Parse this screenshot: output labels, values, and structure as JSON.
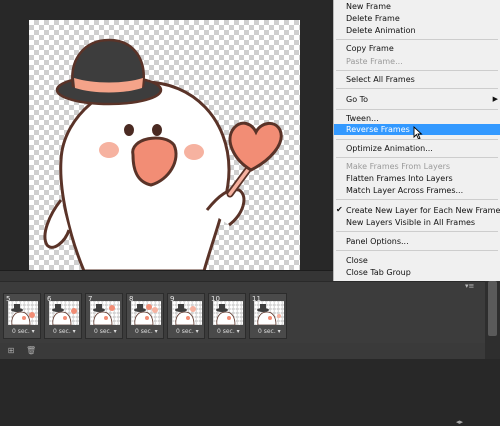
{
  "menu": {
    "items": [
      {
        "label": "New Frame",
        "state": "enabled"
      },
      {
        "label": "Delete Frame",
        "state": "enabled"
      },
      {
        "label": "Delete Animation",
        "state": "enabled"
      },
      {
        "label": "Copy Frame",
        "state": "enabled"
      },
      {
        "label": "Paste Frame...",
        "state": "disabled"
      },
      {
        "label": "Select All Frames",
        "state": "enabled"
      },
      {
        "label": "Go To",
        "state": "enabled",
        "submenu": true
      },
      {
        "label": "Tween...",
        "state": "enabled"
      },
      {
        "label": "Reverse Frames",
        "state": "highlighted"
      },
      {
        "label": "Optimize Animation...",
        "state": "enabled"
      },
      {
        "label": "Make Frames From Layers",
        "state": "disabled"
      },
      {
        "label": "Flatten Frames Into Layers",
        "state": "enabled"
      },
      {
        "label": "Match Layer Across Frames...",
        "state": "enabled"
      },
      {
        "label": "Create New Layer for Each New Frame",
        "state": "enabled",
        "checked": true
      },
      {
        "label": "New Layers Visible in All Frames",
        "state": "enabled"
      },
      {
        "label": "Panel Options...",
        "state": "enabled"
      },
      {
        "label": "Close",
        "state": "enabled"
      },
      {
        "label": "Close Tab Group",
        "state": "enabled"
      }
    ],
    "check_glyph": "✔",
    "submenu_glyph": "▶"
  },
  "timeline": {
    "frames": [
      {
        "number": "5",
        "delay": "0 sec."
      },
      {
        "number": "6",
        "delay": "0 sec."
      },
      {
        "number": "7",
        "delay": "0 sec."
      },
      {
        "number": "8",
        "delay": "0 sec."
      },
      {
        "number": "9",
        "delay": "0 sec."
      },
      {
        "number": "10",
        "delay": "0 sec."
      },
      {
        "number": "11",
        "delay": "0 sec."
      }
    ],
    "delay_arrow": "▾"
  },
  "colors": {
    "menu_highlight": "#3399ff",
    "workspace_bg": "#282828",
    "panel_bg": "#3c3c3c",
    "hat": "#3d3d3d",
    "hat_band": "#f4a389",
    "blush": "#f6b2a0",
    "heart": "#f28d75",
    "outline": "#5a3328"
  },
  "icons": [
    "cursor-arrow-icon",
    "check-icon",
    "submenu-arrow-icon",
    "panel-menu-icon",
    "convert-icon",
    "delete-icon"
  ]
}
